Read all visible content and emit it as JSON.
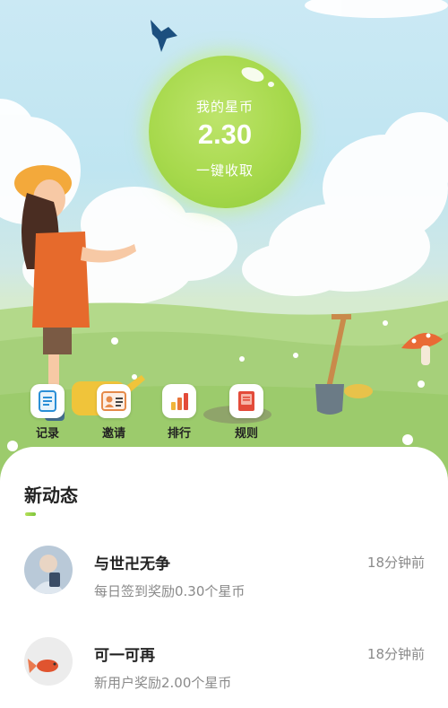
{
  "coin": {
    "label": "我的星币",
    "value": "2.30",
    "claim_label": "一键收取"
  },
  "actions": [
    {
      "label": "记录",
      "icon": "record-icon"
    },
    {
      "label": "邀请",
      "icon": "invite-icon"
    },
    {
      "label": "排行",
      "icon": "ranking-icon"
    },
    {
      "label": "规则",
      "icon": "rules-icon"
    }
  ],
  "feed": {
    "title": "新动态",
    "items": [
      {
        "name": "与世卍无争",
        "desc": "每日签到奖励0.30个星币",
        "time": "18分钟前"
      },
      {
        "name": "可一可再",
        "desc": "新用户奖励2.00个星币",
        "time": "18分钟前"
      }
    ]
  },
  "colors": {
    "accent_green": "#a7d94c",
    "sky": "#c7e7f2",
    "grass": "#a9d27c"
  }
}
